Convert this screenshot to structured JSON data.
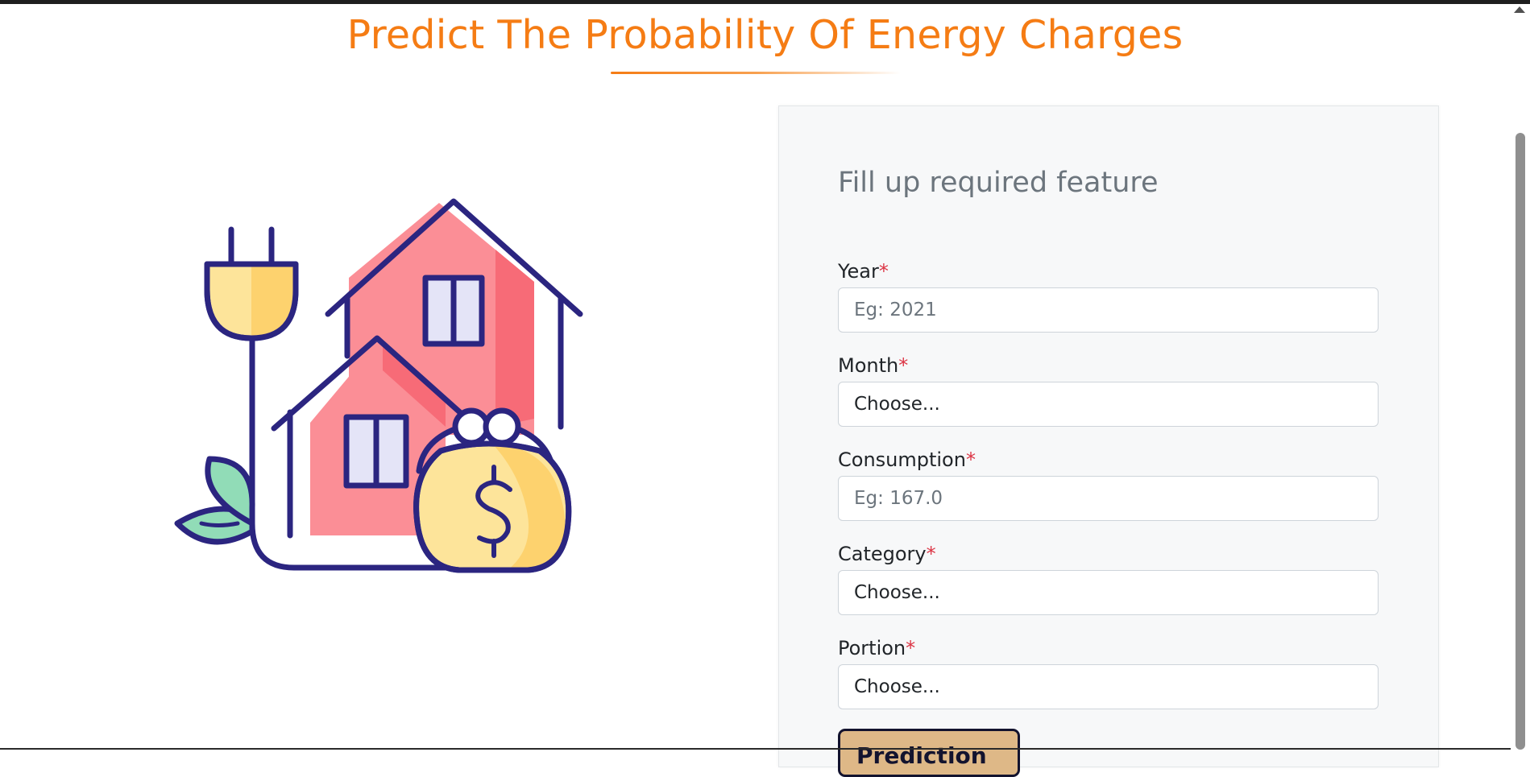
{
  "header": {
    "title": "Predict The Probability Of Energy Charges"
  },
  "illustration": {
    "icon": "house-plug-moneybag-icon"
  },
  "form": {
    "heading": "Fill up required feature",
    "required_marker": "*",
    "fields": [
      {
        "label": "Year",
        "type": "input",
        "placeholder": "Eg: 2021",
        "value": ""
      },
      {
        "label": "Month",
        "type": "select",
        "value": "Choose..."
      },
      {
        "label": "Consumption",
        "type": "input",
        "placeholder": "Eg: 167.0",
        "value": ""
      },
      {
        "label": "Category",
        "type": "select",
        "value": "Choose..."
      },
      {
        "label": "Portion",
        "type": "select",
        "value": "Choose..."
      }
    ],
    "submit_label": "Prediction"
  },
  "colors": {
    "accent": "#f57c14",
    "button": "#deb887",
    "required": "#dc3545"
  }
}
